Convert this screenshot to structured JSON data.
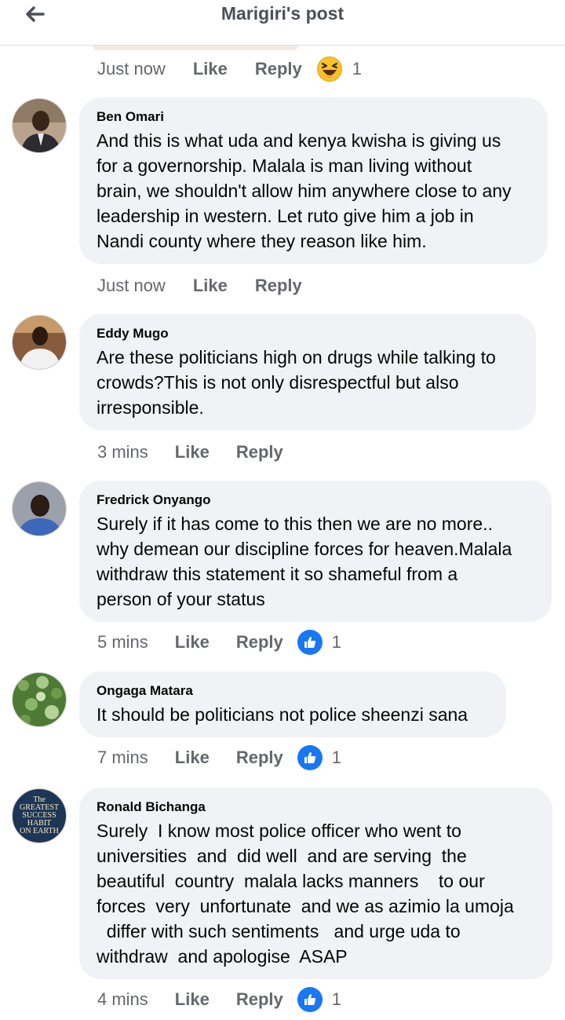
{
  "header": {
    "title": "Marigiri's post"
  },
  "previous_comment": {
    "time": "Just now",
    "like_label": "Like",
    "reply_label": "Reply",
    "reaction": {
      "icon": "haha-emoji-icon",
      "count": "1"
    }
  },
  "comments": [
    {
      "author": "Ben Omari",
      "text": "And this is what uda and kenya kwisha is giving us\nfor a governorship. Malala is man living without\nbrain, we shouldn't allow him anywhere close to any\nleadership in western. Let ruto give him a job in\nNandi county where they reason like him.",
      "time": "Just now",
      "like_label": "Like",
      "reply_label": "Reply"
    },
    {
      "author": "Eddy Mugo",
      "text": "Are these politicians high on drugs while talking to\ncrowds?This is not only disrespectful but also\nirresponsible.",
      "time": "3 mins",
      "like_label": "Like",
      "reply_label": "Reply"
    },
    {
      "author": "Fredrick Onyango",
      "text": "Surely if it has come to this then we are no more..\nwhy demean our discipline forces for heaven.Malala\nwithdraw this statement it so shameful from a\nperson of your status",
      "time": "5 mins",
      "like_label": "Like",
      "reply_label": "Reply",
      "reaction": {
        "icon": "like-icon",
        "count": "1"
      }
    },
    {
      "author": "Ongaga Matara",
      "text": "It should be politicians not police sheenzi sana",
      "time": "7 mins",
      "like_label": "Like",
      "reply_label": "Reply",
      "reaction": {
        "icon": "like-icon",
        "count": "1"
      }
    },
    {
      "author": "Ronald Bichanga",
      "avatar_text": [
        "The",
        "GREATEST",
        "SUCCESS",
        "HABIT",
        "ON EARTH"
      ],
      "text": "Surely  I know most police officer who went to\nuniversities  and  did well  and are serving  the\nbeautiful  country  malala lacks manners    to our\nforces  very  unfortunate  and we as azimio la umoja\n  differ with such sentiments   and urge uda to\nwithdraw  and apologise  ASAP",
      "time": "4 mins",
      "like_label": "Like",
      "reply_label": "Reply",
      "reaction": {
        "icon": "like-icon",
        "count": "1"
      }
    }
  ],
  "colors": {
    "bubble": "#f0f2f5",
    "meta_text": "#65676b",
    "like_blue": "#1877f2"
  }
}
